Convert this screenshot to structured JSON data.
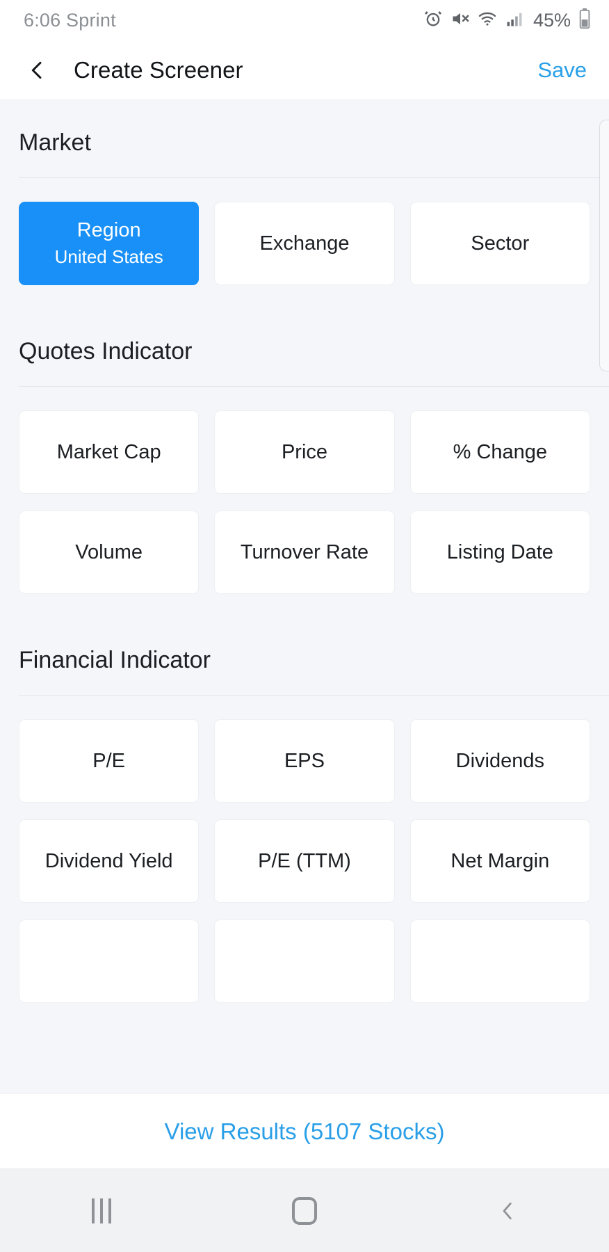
{
  "statusbar": {
    "time_carrier": "6:06 Sprint",
    "battery_percent": "45%",
    "icons": [
      "alarm-icon",
      "mute-icon",
      "wifi-icon",
      "signal-icon",
      "battery-icon"
    ]
  },
  "header": {
    "back_icon": "chevron-left-icon",
    "title": "Create Screener",
    "save_label": "Save"
  },
  "sections": [
    {
      "title": "Market",
      "cards": [
        {
          "label": "Region",
          "sub": "United States",
          "selected": true
        },
        {
          "label": "Exchange",
          "sub": "",
          "selected": false
        },
        {
          "label": "Sector",
          "sub": "",
          "selected": false
        }
      ]
    },
    {
      "title": "Quotes Indicator",
      "cards": [
        {
          "label": "Market Cap",
          "sub": "",
          "selected": false
        },
        {
          "label": "Price",
          "sub": "",
          "selected": false
        },
        {
          "label": "% Change",
          "sub": "",
          "selected": false
        },
        {
          "label": "Volume",
          "sub": "",
          "selected": false
        },
        {
          "label": "Turnover Rate",
          "sub": "",
          "selected": false
        },
        {
          "label": "Listing Date",
          "sub": "",
          "selected": false
        }
      ]
    },
    {
      "title": "Financial Indicator",
      "cards": [
        {
          "label": "P/E",
          "sub": "",
          "selected": false
        },
        {
          "label": "EPS",
          "sub": "",
          "selected": false
        },
        {
          "label": "Dividends",
          "sub": "",
          "selected": false
        },
        {
          "label": "Dividend Yield",
          "sub": "",
          "selected": false
        },
        {
          "label": "P/E (TTM)",
          "sub": "",
          "selected": false
        },
        {
          "label": "Net Margin",
          "sub": "",
          "selected": false
        },
        {
          "label": "",
          "sub": "",
          "selected": false
        },
        {
          "label": "",
          "sub": "",
          "selected": false
        },
        {
          "label": "",
          "sub": "",
          "selected": false
        }
      ]
    }
  ],
  "bottom_action": {
    "label": "View Results (5107 Stocks)"
  },
  "navbar": {
    "recents_icon": "recents-icon",
    "home_icon": "home-icon",
    "back_icon": "back-icon"
  },
  "colors": {
    "accent_blue": "#1890f7",
    "link_blue": "#2a9fe8",
    "page_bg": "#f4f6f9",
    "card_bg": "#ffffff"
  }
}
